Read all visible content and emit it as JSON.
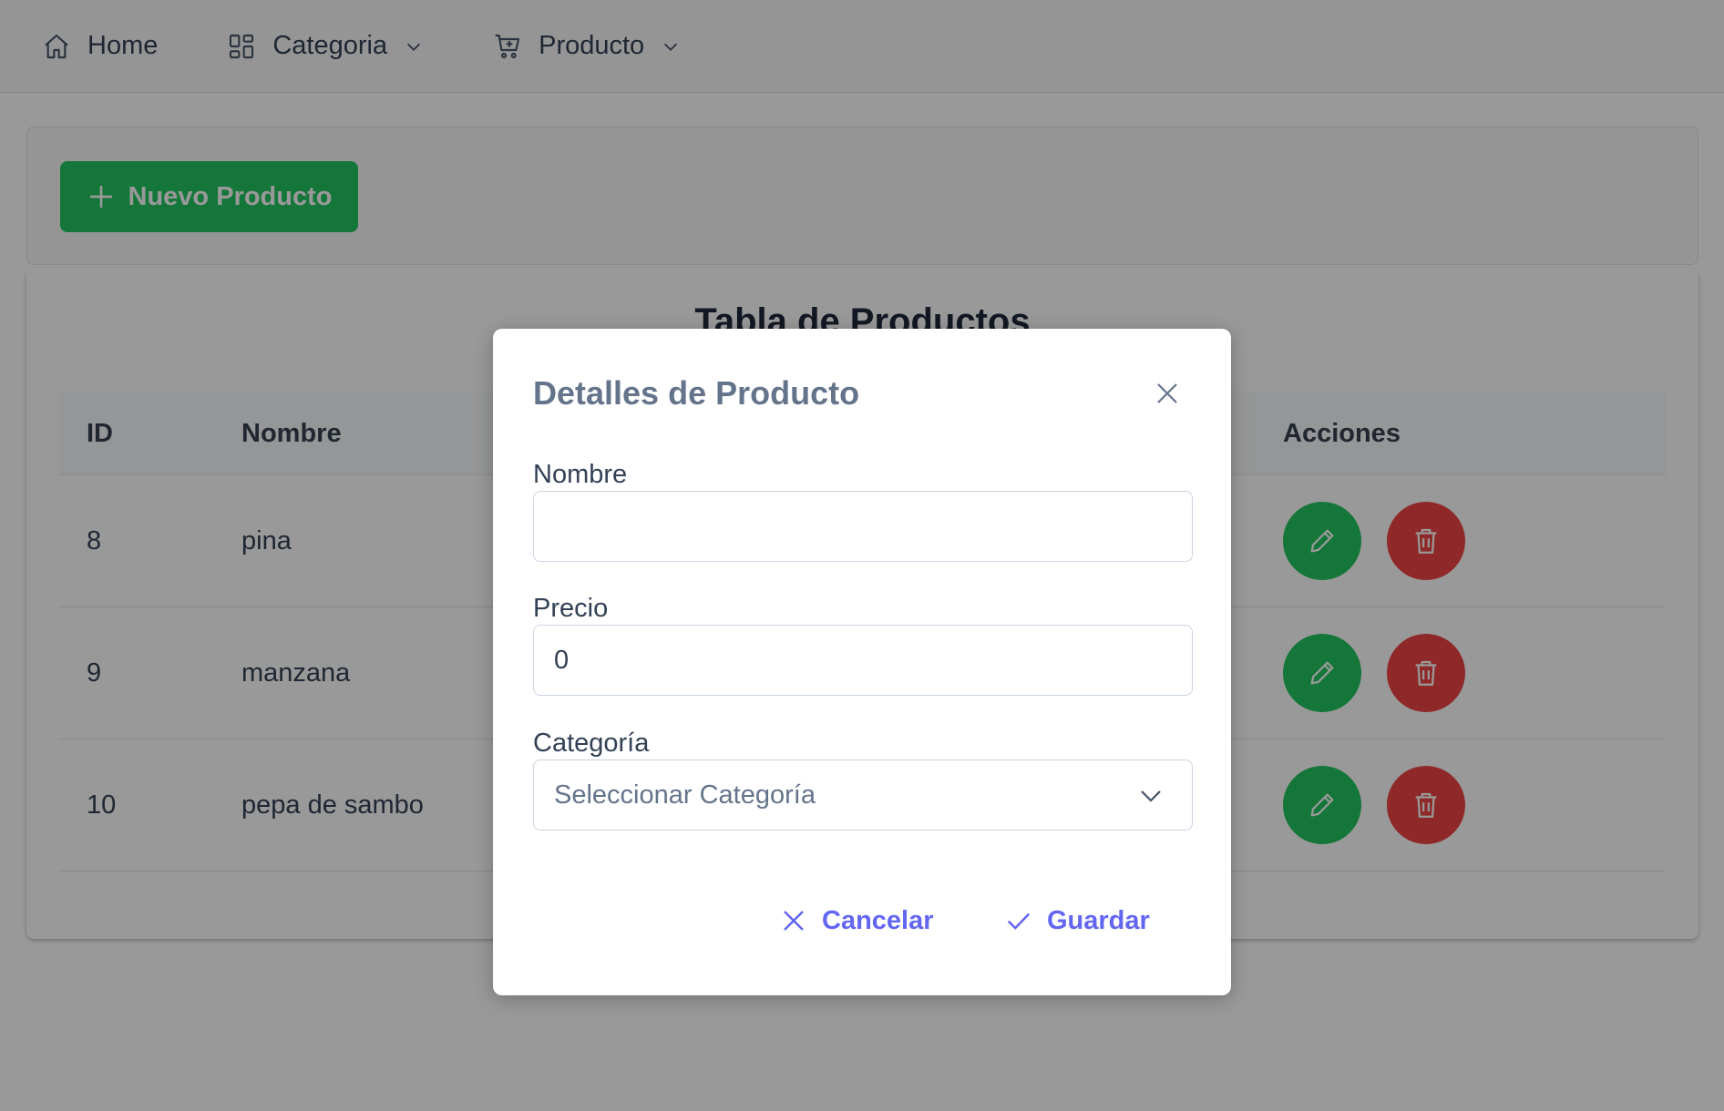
{
  "menubar": {
    "items": [
      {
        "label": "Home",
        "icon": "home-icon"
      },
      {
        "label": "Categoria",
        "icon": "grid-icon"
      },
      {
        "label": "Producto",
        "icon": "cart-icon"
      }
    ]
  },
  "toolbar": {
    "new_button_label": "Nuevo Producto"
  },
  "table": {
    "title": "Tabla de Productos",
    "headers": {
      "id": "ID",
      "name": "Nombre",
      "actions": "Acciones"
    },
    "rows": [
      {
        "id": "8",
        "name": "pina"
      },
      {
        "id": "9",
        "name": "manzana"
      },
      {
        "id": "10",
        "name": "pepa de sambo"
      }
    ]
  },
  "dialog": {
    "title": "Detalles de Producto",
    "fields": {
      "name_label": "Nombre",
      "name_value": "",
      "price_label": "Precio",
      "price_value": "0",
      "category_label": "Categoría",
      "category_placeholder": "Seleccionar Categoría"
    },
    "cancel_label": "Cancelar",
    "save_label": "Guardar"
  },
  "colors": {
    "success": "#22c55e",
    "danger": "#ef4444",
    "primary": "#6366f1"
  }
}
